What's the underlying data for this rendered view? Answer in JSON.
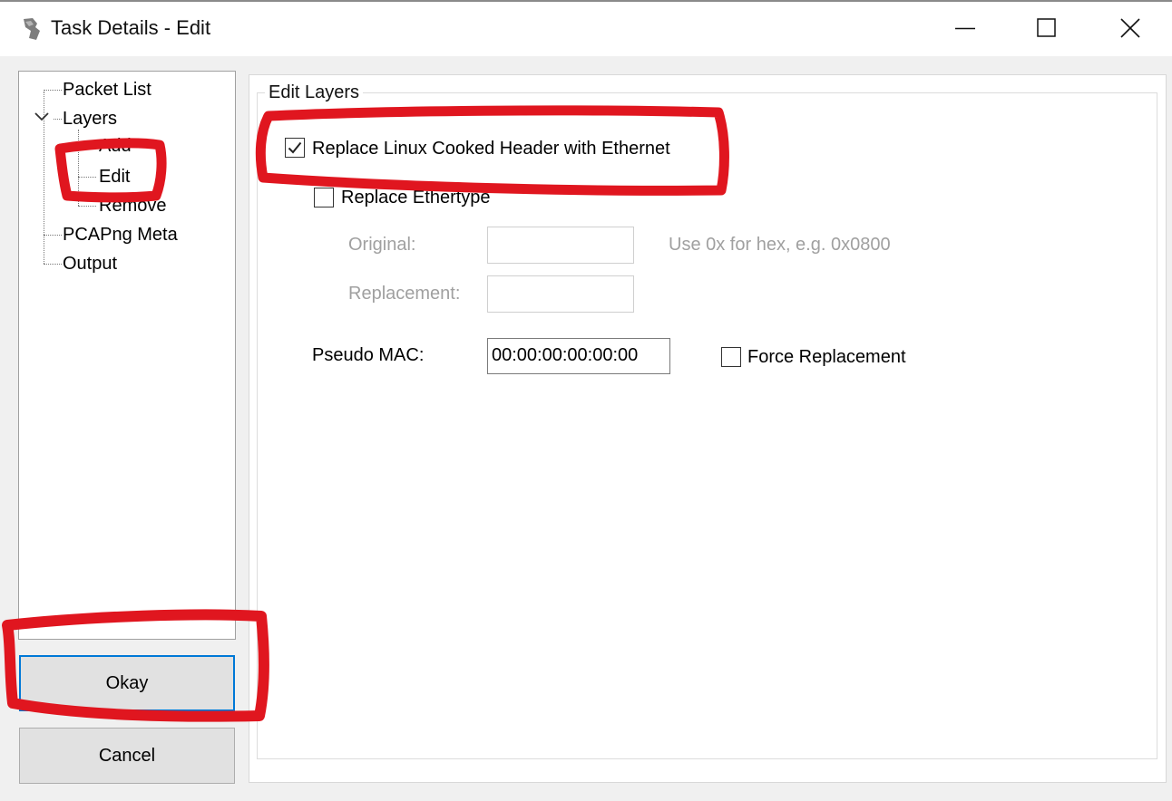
{
  "window": {
    "title": "Task Details - Edit",
    "controls": {
      "minimize": "minimize-icon",
      "maximize": "maximize-icon",
      "close": "close-icon"
    }
  },
  "tree": {
    "items": [
      {
        "label": "Packet List"
      },
      {
        "label": "Layers",
        "expanded": true
      },
      {
        "label": "Add"
      },
      {
        "label": "Edit",
        "selected": true
      },
      {
        "label": "Remove"
      },
      {
        "label": "PCAPng Meta"
      },
      {
        "label": "Output"
      }
    ]
  },
  "buttons": {
    "okay": "Okay",
    "cancel": "Cancel"
  },
  "edit_layers": {
    "group_title": "Edit Layers",
    "replace_cooked": {
      "label": "Replace Linux Cooked Header with Ethernet",
      "checked": true
    },
    "replace_ethertype": {
      "label": "Replace Ethertype",
      "checked": false
    },
    "original": {
      "label": "Original:",
      "value": ""
    },
    "replacement": {
      "label": "Replacement:",
      "value": ""
    },
    "hex_hint": "Use 0x for hex, e.g. 0x0800",
    "pseudo_mac": {
      "label": "Pseudo MAC:",
      "value": "00:00:00:00:00:00"
    },
    "force_replacement": {
      "label": "Force Replacement",
      "checked": false
    }
  },
  "colors": {
    "annotation": "#e0161f",
    "focus_border": "#0078d7",
    "disabled_text": "#a0a0a0"
  }
}
